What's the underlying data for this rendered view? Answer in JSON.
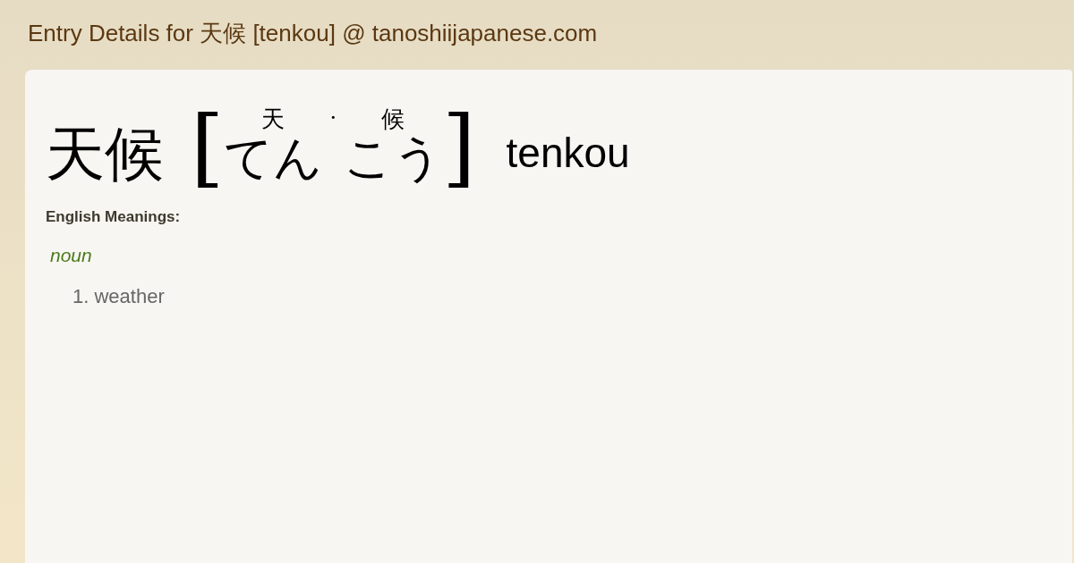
{
  "page_title": "Entry Details for 天候 [tenkou] @ tanoshiijapanese.com",
  "entry": {
    "kanji": "天候",
    "bracket_open": "[",
    "bracket_close": "]",
    "separator": "·",
    "reading": [
      {
        "kanji": "天",
        "kana": "てん"
      },
      {
        "kanji": "候",
        "kana": "こう"
      }
    ],
    "romaji": "tenkou"
  },
  "meanings_heading": "English Meanings:",
  "part_of_speech": "noun",
  "meanings": [
    "1. weather"
  ]
}
